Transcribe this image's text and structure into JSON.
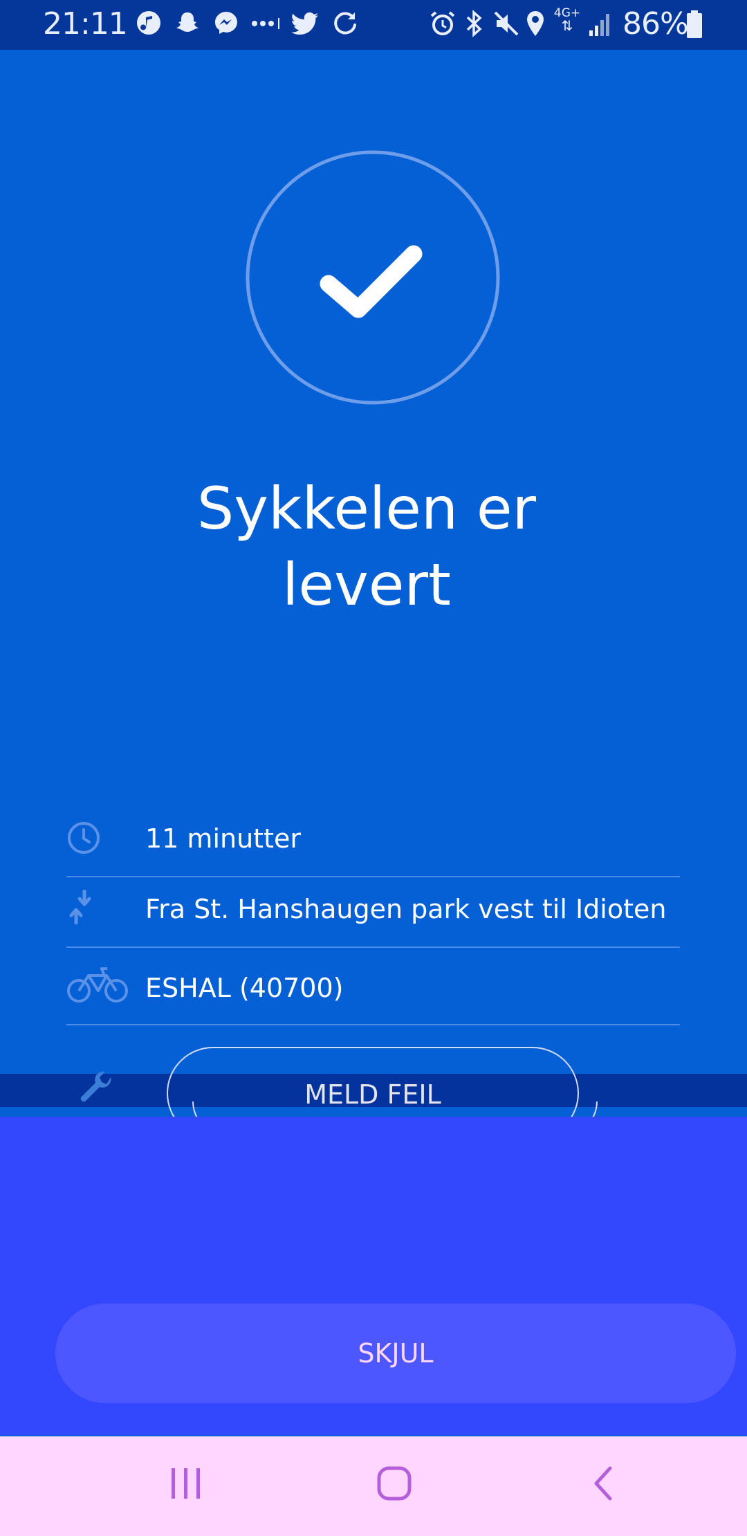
{
  "status_bar": {
    "time": "21:11",
    "battery": "86%",
    "network": "4G+"
  },
  "confirmation": {
    "title_line1": "Sykkelen er",
    "title_line2": "levert"
  },
  "trip_details": [
    {
      "icon": "clock-icon",
      "text": "11 minutter"
    },
    {
      "icon": "route-icon",
      "text": "Fra St. Hanshaugen park vest til Idioten"
    },
    {
      "icon": "bicycle-icon",
      "text": "ESHAL (40700)"
    }
  ],
  "report": {
    "icon": "wrench-icon",
    "label": "MELD FEIL"
  },
  "hide_button": {
    "label": "SKJUL"
  },
  "colors": {
    "background": "#0560d6",
    "status_bar": "#05379a",
    "sheet": "#3347fd",
    "hide_button": "#4d57ff",
    "nav_bar": "#ffd6ff",
    "nav_icons": "#b45edb"
  }
}
